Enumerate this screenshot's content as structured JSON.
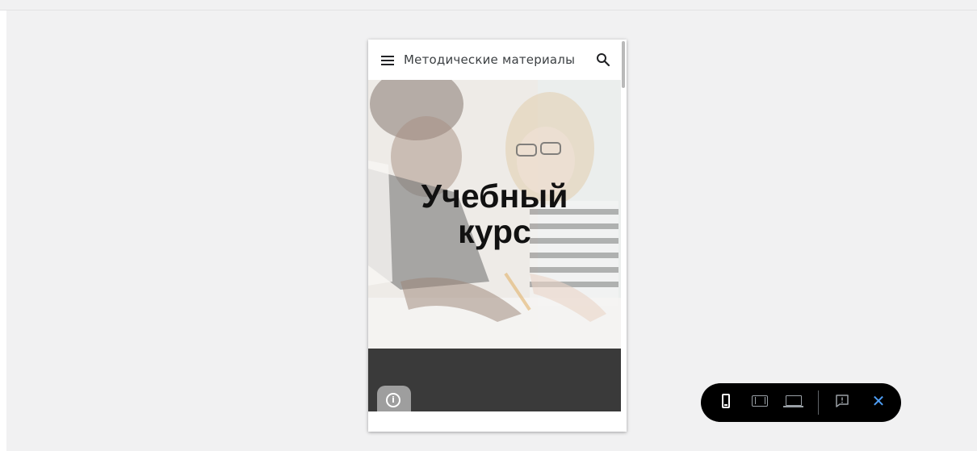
{
  "site": {
    "title": "Методические материалы"
  },
  "hero": {
    "title_line1": "Учебный",
    "title_line2": "курс"
  },
  "info_button": {
    "glyph": "i"
  },
  "toolbar": {
    "close_glyph": "✕",
    "selected_view": "phone"
  },
  "colors": {
    "page_background": "#f1f1f2",
    "toolbar_background": "#000000",
    "close_accent": "#4e9ef5",
    "dark_band": "#3a3a3a"
  },
  "icons": [
    "menu-icon",
    "search-icon",
    "info-icon",
    "phone-view-icon",
    "tablet-view-icon",
    "laptop-view-icon",
    "feedback-icon",
    "close-icon"
  ]
}
